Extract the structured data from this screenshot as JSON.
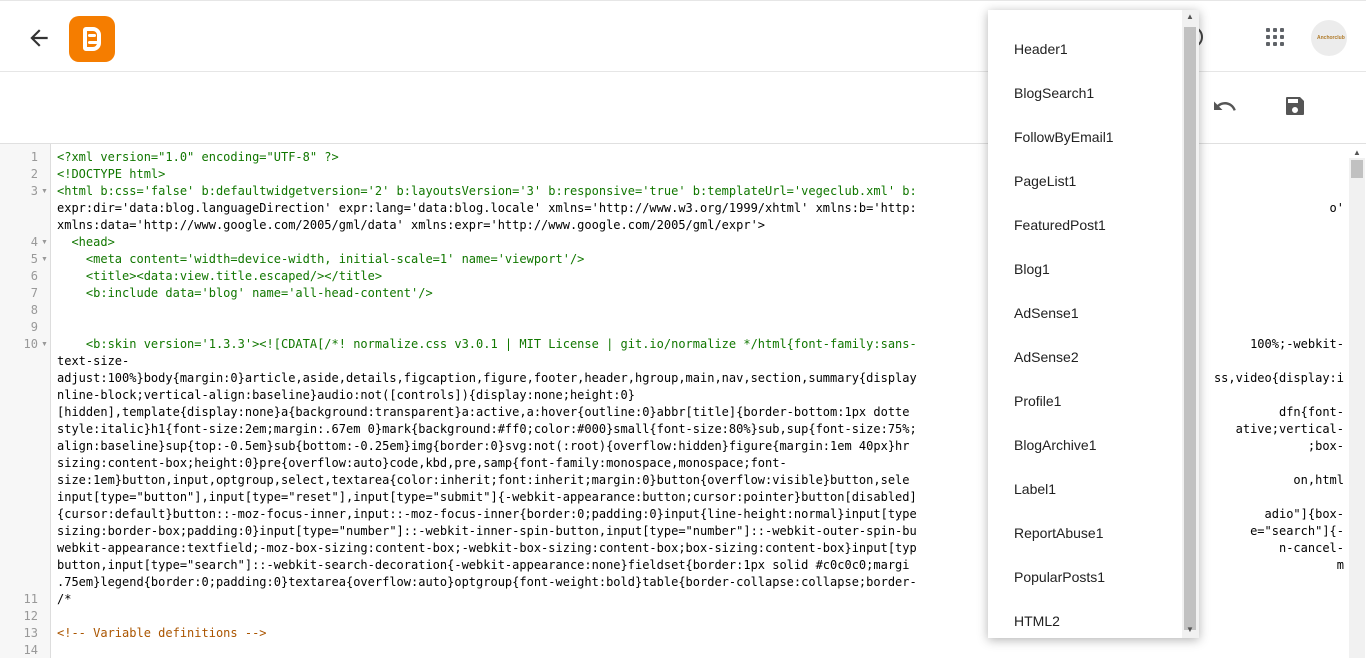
{
  "header": {
    "back_icon": "arrow-back-icon",
    "logo": "blogger-logo",
    "apps_icon": "apps-grid-icon",
    "avatar_text": "Anchorclub"
  },
  "toolbar": {
    "undo_icon": "undo-icon",
    "save_icon": "save-icon"
  },
  "editor": {
    "line_numbers": [
      "1",
      "2",
      "3",
      "",
      "",
      "4",
      "5",
      "6",
      "7",
      "8",
      "9",
      "10",
      "",
      "",
      "",
      "",
      "",
      "",
      "",
      "",
      "",
      "",
      "",
      "",
      "",
      "",
      "11",
      "12",
      "13",
      "14"
    ],
    "lines": [
      "<?xml version=\"1.0\" encoding=\"UTF-8\" ?>",
      "<!DOCTYPE html>",
      "<html b:css='false' b:defaultwidgetversion='2' b:layoutsVersion='3' b:responsive='true' b:templateUrl='vegeclub.xml' b:",
      "expr:dir='data:blog.languageDirection' expr:lang='data:blog.locale' xmlns='http://www.w3.org/1999/xhtml' xmlns:b='http:",
      "xmlns:data='http://www.google.com/2005/gml/data' xmlns:expr='http://www.google.com/2005/gml/expr'>",
      "  <head>",
      "    <meta content='width=device-width, initial-scale=1' name='viewport'/>",
      "    <title><data:view.title.escaped/></title>",
      "    <b:include data='blog' name='all-head-content'/>",
      "",
      "",
      "    <b:skin version='1.3.3'><![CDATA[/*! normalize.css v3.0.1 | MIT License | git.io/normalize */html{font-family:sans-",
      "text-size-",
      "adjust:100%}body{margin:0}article,aside,details,figcaption,figure,footer,header,hgroup,main,nav,section,summary{display",
      "nline-block;vertical-align:baseline}audio:not([controls]){display:none;height:0}",
      "[hidden],template{display:none}a{background:transparent}a:active,a:hover{outline:0}abbr[title]{border-bottom:1px dotte",
      "style:italic}h1{font-size:2em;margin:.67em 0}mark{background:#ff0;color:#000}small{font-size:80%}sub,sup{font-size:75%;",
      "align:baseline}sup{top:-0.5em}sub{bottom:-0.25em}img{border:0}svg:not(:root){overflow:hidden}figure{margin:1em 40px}hr",
      "sizing:content-box;height:0}pre{overflow:auto}code,kbd,pre,samp{font-family:monospace,monospace;font-",
      "size:1em}button,input,optgroup,select,textarea{color:inherit;font:inherit;margin:0}button{overflow:visible}button,sele",
      "input[type=\"button\"],input[type=\"reset\"],input[type=\"submit\"]{-webkit-appearance:button;cursor:pointer}button[disabled]",
      "{cursor:default}button::-moz-focus-inner,input::-moz-focus-inner{border:0;padding:0}input{line-height:normal}input[type",
      "sizing:border-box;padding:0}input[type=\"number\"]::-webkit-inner-spin-button,input[type=\"number\"]::-webkit-outer-spin-bu",
      "webkit-appearance:textfield;-moz-box-sizing:content-box;-webkit-box-sizing:content-box;box-sizing:content-box}input[typ",
      "button,input[type=\"search\"]::-webkit-search-decoration{-webkit-appearance:none}fieldset{border:1px solid #c0c0c0;margi",
      ".75em}legend{border:0;padding:0}textarea{overflow:auto}optgroup{font-weight:bold}table{border-collapse:collapse;border-",
      "/*",
      "",
      "<!-- Variable definitions -->",
      ""
    ],
    "right_fragments": [
      {
        "row": 2,
        "text": ""
      },
      {
        "row": 3,
        "text": "o'"
      },
      {
        "row": 11,
        "text": "100%;-webkit-"
      },
      {
        "row": 13,
        "text": "ss,video{display:i"
      },
      {
        "row": 15,
        "text": "dfn{font-"
      },
      {
        "row": 16,
        "text": "ative;vertical-"
      },
      {
        "row": 17,
        "text": ";box-"
      },
      {
        "row": 19,
        "text": "on,html"
      },
      {
        "row": 21,
        "text": "adio\"]{box-"
      },
      {
        "row": 22,
        "text": "e=\"search\"]{-"
      },
      {
        "row": 23,
        "text": "n-cancel-"
      },
      {
        "row": 24,
        "text": "m"
      }
    ]
  },
  "widget_menu": {
    "items": [
      "Header1",
      "BlogSearch1",
      "FollowByEmail1",
      "PageList1",
      "FeaturedPost1",
      "Blog1",
      "AdSense1",
      "AdSense2",
      "Profile1",
      "BlogArchive1",
      "Label1",
      "ReportAbuse1",
      "PopularPosts1",
      "HTML2"
    ]
  }
}
